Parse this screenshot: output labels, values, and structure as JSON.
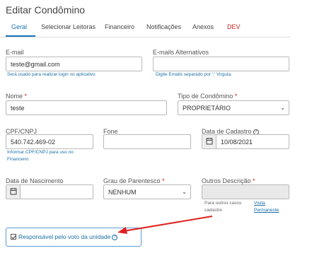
{
  "page": {
    "title": "Editar Condômino"
  },
  "tabs": [
    {
      "label": "Geral"
    },
    {
      "label": "Selecionar Leitoras"
    },
    {
      "label": "Financeiro"
    },
    {
      "label": "Notificações"
    },
    {
      "label": "Anexos"
    },
    {
      "label": "DEV"
    }
  ],
  "form": {
    "email": {
      "label": "E-mail",
      "value": "teste@gmail.com",
      "help": "Será usado para realizar login no aplicativo"
    },
    "alt_emails": {
      "label": "E-mails Alternativos",
      "value": "",
      "help": "Digite Emails separado por ';' Virgula."
    },
    "nome": {
      "label": "Nome",
      "required": "*",
      "value": "teste"
    },
    "tipo": {
      "label": "Tipo de Condômino",
      "required": "*",
      "value": "PROPRIETÁRIO"
    },
    "cpf": {
      "label": "CPF/CNPJ",
      "value": "540.742.469-02",
      "help_line1": "Informar CPF/CNPJ para uso no",
      "help_line2": "Financeiro"
    },
    "fone": {
      "label": "Fone",
      "value": ""
    },
    "data_cadastro": {
      "label": "Data de Cadastro",
      "value": "10/08/2021"
    },
    "data_nascimento": {
      "label": "Data de Nascimento",
      "value": ""
    },
    "grau": {
      "label": "Grau de Parentesco",
      "required": "*",
      "value": "NENHUM"
    },
    "outros": {
      "label": "Outros Descrição",
      "required": "*",
      "value": "",
      "note_line1": "Para outros casos",
      "note_line2": "cadastre",
      "link1": "Visita",
      "link2": "Permanente"
    },
    "responsavel": {
      "label": "Responsável pelo voto da unidade",
      "checked": true
    }
  },
  "colors": {
    "accent": "#1a73b8",
    "danger": "#cc1f1f",
    "arrow": "#e02020"
  }
}
